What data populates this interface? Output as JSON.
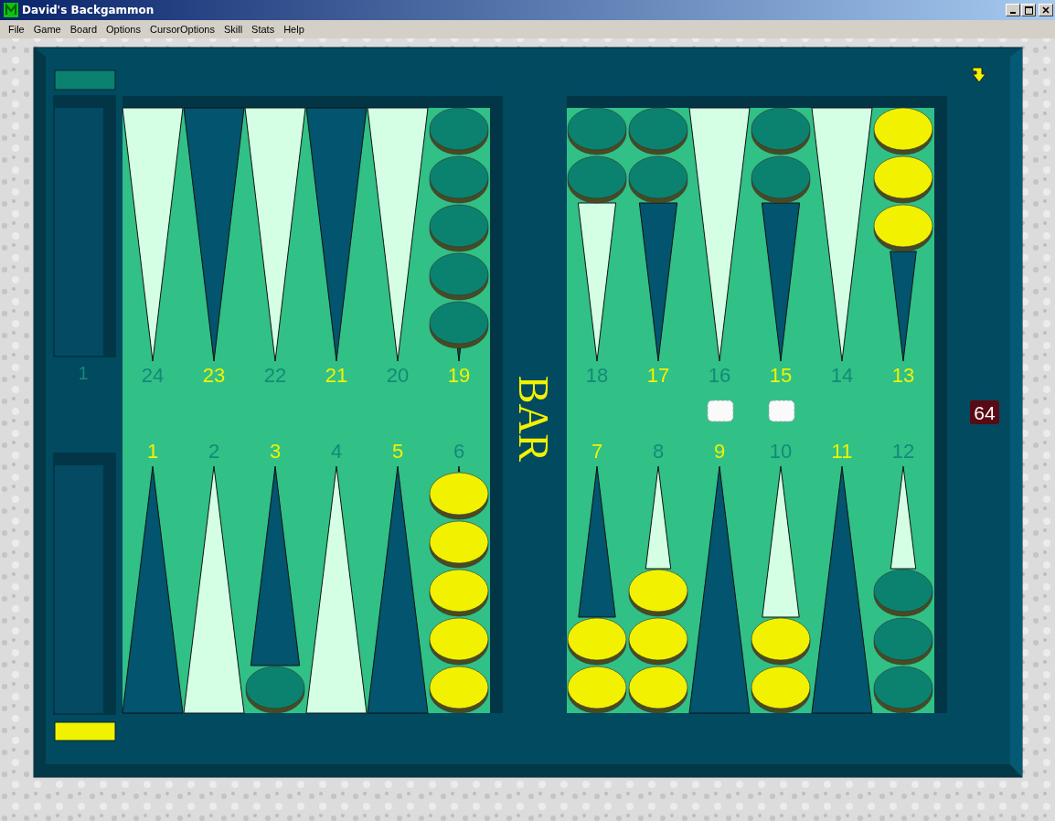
{
  "window": {
    "title": "David's Backgammon"
  },
  "menu": [
    {
      "label": "File"
    },
    {
      "label": "Game"
    },
    {
      "label": "Board"
    },
    {
      "label": "Options"
    },
    {
      "label": "CursorOptions"
    },
    {
      "label": "Skill"
    },
    {
      "label": "Stats"
    },
    {
      "label": "Help"
    }
  ],
  "board": {
    "top_left": [
      {
        "label": "24",
        "color": "#138a78",
        "kind": "light"
      },
      {
        "label": "23",
        "color": "#f2f200",
        "kind": "dark"
      },
      {
        "label": "22",
        "color": "#138a78",
        "kind": "light"
      },
      {
        "label": "21",
        "color": "#f2f200",
        "kind": "dark"
      },
      {
        "label": "20",
        "color": "#138a78",
        "kind": "light"
      },
      {
        "label": "19",
        "color": "#f2f200",
        "kind": "dark",
        "checkers": [
          {
            "color": "#0b8270"
          },
          {
            "color": "#0b8270"
          },
          {
            "color": "#0b8270"
          },
          {
            "color": "#0b8270"
          },
          {
            "color": "#0b8270"
          }
        ]
      }
    ],
    "top_right": [
      {
        "label": "18",
        "color": "#138a78",
        "kind": "light",
        "checkers": [
          {
            "color": "#0b8270"
          },
          {
            "color": "#0b8270"
          }
        ]
      },
      {
        "label": "17",
        "color": "#f2f200",
        "kind": "dark",
        "checkers": [
          {
            "color": "#0b8270"
          },
          {
            "color": "#0b8270"
          }
        ]
      },
      {
        "label": "16",
        "color": "#138a78",
        "kind": "light"
      },
      {
        "label": "15",
        "color": "#f2f200",
        "kind": "dark",
        "checkers": [
          {
            "color": "#0b8270"
          },
          {
            "color": "#0b8270"
          }
        ]
      },
      {
        "label": "14",
        "color": "#138a78",
        "kind": "light"
      },
      {
        "label": "13",
        "color": "#f2f200",
        "kind": "dark",
        "checkers": [
          {
            "color": "#f2f200"
          },
          {
            "color": "#f2f200"
          },
          {
            "color": "#f2f200"
          }
        ]
      }
    ],
    "bottom_left": [
      {
        "label": "1",
        "color": "#f2f200",
        "kind": "dark"
      },
      {
        "label": "2",
        "color": "#138a78",
        "kind": "light"
      },
      {
        "label": "3",
        "color": "#f2f200",
        "kind": "dark",
        "checkers": [
          {
            "color": "#0b8270"
          }
        ]
      },
      {
        "label": "4",
        "color": "#138a78",
        "kind": "light"
      },
      {
        "label": "5",
        "color": "#f2f200",
        "kind": "dark"
      },
      {
        "label": "6",
        "color": "#138a78",
        "kind": "light",
        "checkers": [
          {
            "color": "#f2f200"
          },
          {
            "color": "#f2f200"
          },
          {
            "color": "#f2f200"
          },
          {
            "color": "#f2f200"
          },
          {
            "color": "#f2f200"
          }
        ]
      }
    ],
    "bottom_right": [
      {
        "label": "7",
        "color": "#f2f200",
        "kind": "dark",
        "checkers": [
          {
            "color": "#f2f200"
          },
          {
            "color": "#f2f200"
          }
        ]
      },
      {
        "label": "8",
        "color": "#138a78",
        "kind": "light",
        "checkers": [
          {
            "color": "#f2f200"
          },
          {
            "color": "#f2f200"
          },
          {
            "color": "#f2f200"
          }
        ]
      },
      {
        "label": "9",
        "color": "#f2f200",
        "kind": "dark"
      },
      {
        "label": "10",
        "color": "#138a78",
        "kind": "light",
        "checkers": [
          {
            "color": "#f2f200"
          },
          {
            "color": "#f2f200"
          }
        ]
      },
      {
        "label": "11",
        "color": "#f2f200",
        "kind": "dark"
      },
      {
        "label": "12",
        "color": "#138a78",
        "kind": "light",
        "checkers": [
          {
            "color": "#0b8270"
          },
          {
            "color": "#0b8270"
          },
          {
            "color": "#0b8270"
          }
        ]
      }
    ],
    "bar_label": "BAR",
    "tray_count": "1",
    "doubling_cube": "64"
  }
}
